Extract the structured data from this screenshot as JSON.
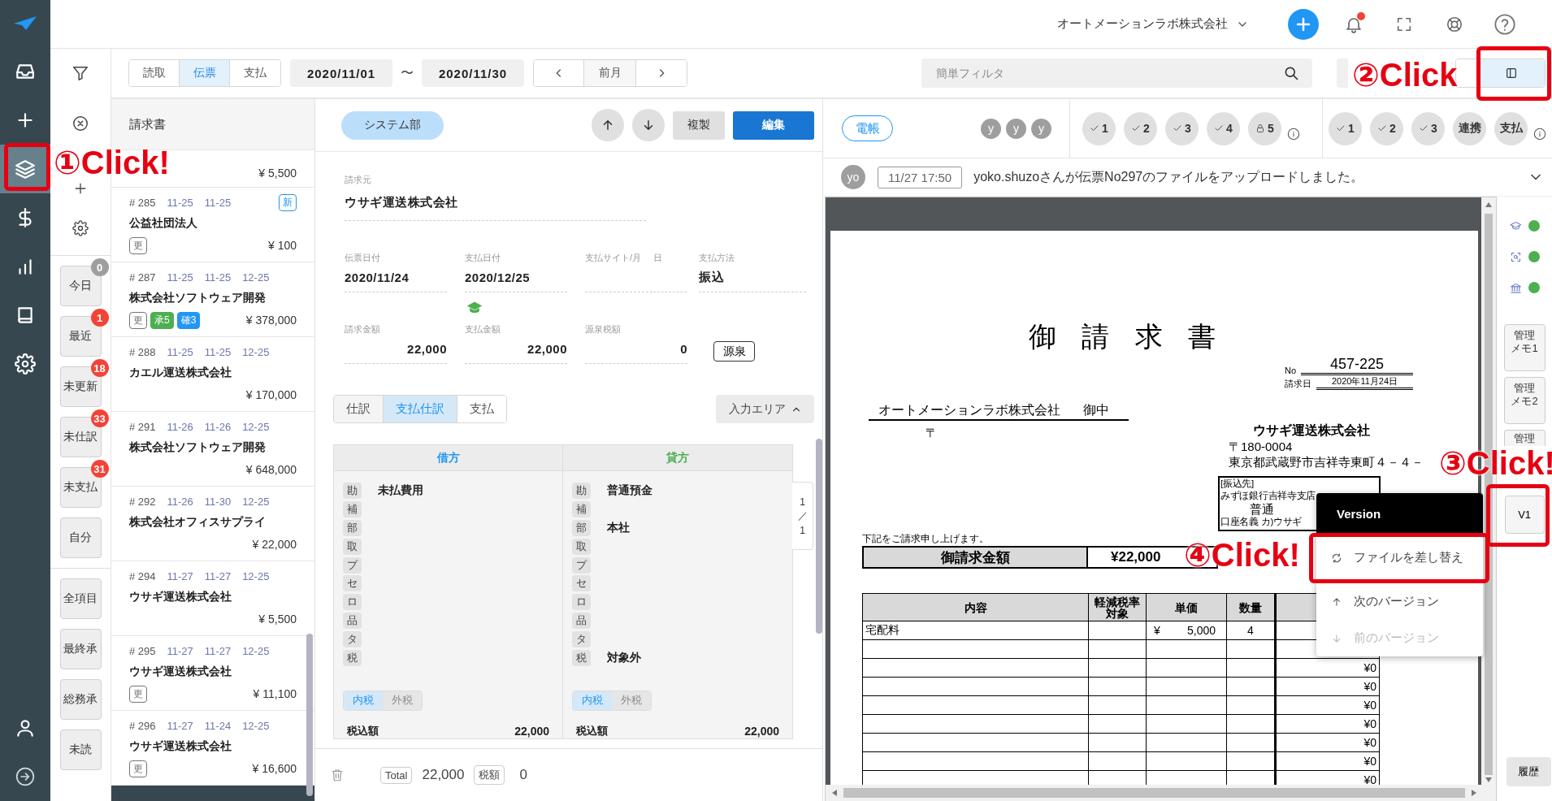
{
  "nav_rail": {
    "items": [
      {
        "selected": false
      },
      {
        "selected": false
      },
      {
        "selected": true
      },
      {
        "selected": false
      },
      {
        "selected": false
      },
      {
        "selected": false
      },
      {
        "selected": false
      }
    ]
  },
  "header": {
    "company": "オートメーションラボ株式会社",
    "unread_notifications": true
  },
  "toolbar": {
    "modes": [
      {
        "label": "読取",
        "selected": false
      },
      {
        "label": "伝票",
        "selected": true
      },
      {
        "label": "支払",
        "selected": false
      }
    ],
    "date_from": "2020/11/01",
    "range_separator": "〜",
    "date_to": "2020/11/30",
    "month_button": "前月",
    "search": {
      "placeholder": "簡単フィルタ"
    },
    "layout_toggle": [
      {
        "selected": false
      },
      {
        "selected": true
      }
    ]
  },
  "filters": {
    "quick": [
      {
        "label": "今日",
        "count": "0",
        "color": "#9e9e9e"
      },
      {
        "label": "最近",
        "count": "1",
        "color": "#f44336"
      },
      {
        "label": "未更新",
        "count": "18",
        "color": "#f44336"
      },
      {
        "label": "未仕訳",
        "count": "33",
        "color": "#f44336"
      },
      {
        "label": "未支払",
        "count": "31",
        "color": "#f44336"
      },
      {
        "label": "自分"
      }
    ],
    "approval": [
      {
        "label": "全項目"
      },
      {
        "label": "最終承"
      },
      {
        "label": "総務承"
      },
      {
        "label": "未読"
      }
    ]
  },
  "list": {
    "title": "請求書",
    "items": [
      {
        "amount": "¥ 5,500",
        "selected": false
      },
      {
        "number": "# 285",
        "dates": [
          "11-25",
          "11-25"
        ],
        "badge": "新",
        "name": "公益社団法人",
        "tags": [
          {
            "label": "更",
            "kind": "outline",
            "color": "#757575"
          }
        ],
        "amount": "¥ 100",
        "selected": false
      },
      {
        "number": "# 287",
        "dates": [
          "11-25",
          "11-25",
          "12-25"
        ],
        "name": "株式会社ソフトウェア開発",
        "tags": [
          {
            "label": "更",
            "kind": "outline",
            "color": "#757575"
          },
          {
            "label": "承5",
            "kind": "filled",
            "color": "#4caf50"
          },
          {
            "label": "確3",
            "kind": "filled",
            "color": "#2196f3"
          }
        ],
        "amount": "¥ 378,000",
        "selected": false
      },
      {
        "number": "# 288",
        "dates": [
          "11-25",
          "11-25",
          "12-25"
        ],
        "name": "カエル運送株式会社",
        "amount": "¥ 170,000",
        "selected": false
      },
      {
        "number": "# 291",
        "dates": [
          "11-26",
          "11-26",
          "12-25"
        ],
        "name": "株式会社ソフトウェア開発",
        "amount": "¥ 648,000",
        "selected": false
      },
      {
        "number": "# 292",
        "dates": [
          "11-26",
          "11-30",
          "12-25"
        ],
        "name": "株式会社オフィスサプライ",
        "amount": "¥ 22,000",
        "selected": false
      },
      {
        "number": "# 294",
        "dates": [
          "11-27",
          "11-27",
          "12-25"
        ],
        "name": "ウサギ運送株式会社",
        "amount": "¥ 5,500",
        "selected": false
      },
      {
        "number": "# 295",
        "dates": [
          "11-27",
          "11-27",
          "12-25"
        ],
        "name": "ウサギ運送株式会社",
        "tags": [
          {
            "label": "更",
            "kind": "outline",
            "color": "#757575"
          }
        ],
        "amount": "¥ 11,100",
        "selected": false
      },
      {
        "number": "# 296",
        "dates": [
          "11-27",
          "11-24",
          "12-25"
        ],
        "name": "ウサギ運送株式会社",
        "tags": [
          {
            "label": "更",
            "kind": "outline",
            "color": "#757575"
          }
        ],
        "amount": "¥ 16,600",
        "selected": false
      },
      {
        "selected": true
      }
    ]
  },
  "detail": {
    "department": "システム部",
    "copy_button": "複製",
    "edit_button": "編集",
    "biller": {
      "label": "請求元",
      "value": "ウサギ運送株式会社"
    },
    "date_fields": [
      {
        "label": "伝票日付",
        "value": "2020/11/24"
      },
      {
        "label": "支払日付",
        "value": "2020/12/25",
        "verified": true
      },
      {
        "label": "支払サイト/月"
      },
      {
        "label": "日"
      },
      {
        "label": "支払方法",
        "value": "振込"
      }
    ],
    "amount_fields": [
      {
        "label": "請求金額",
        "value": "22,000"
      },
      {
        "label": "支払金額",
        "value": "22,000"
      },
      {
        "label": "源泉税額",
        "value": "0"
      }
    ],
    "withholding_button": "源泉",
    "tabs": [
      {
        "label": "仕訳",
        "selected": false
      },
      {
        "label": "支払仕訳",
        "selected": true
      },
      {
        "label": "支払",
        "selected": false
      }
    ],
    "input_area_button": "入力エリア",
    "journal": {
      "sides": [
        {
          "title": "借方",
          "color": "#2196f3",
          "rows": [
            {
              "key": "勘",
              "value": "未払費用"
            },
            {
              "key": "補"
            },
            {
              "key": "部"
            },
            {
              "key": "取"
            },
            {
              "key": "プ"
            },
            {
              "key": "セ"
            },
            {
              "key": "ロ"
            },
            {
              "key": "品"
            },
            {
              "key": "タ"
            },
            {
              "key": "税"
            }
          ],
          "tax_modes": [
            {
              "label": "内税",
              "selected": true
            },
            {
              "label": "外税",
              "selected": false
            }
          ],
          "total_label": "税込額",
          "total": "22,000"
        },
        {
          "title": "貸方",
          "color": "#4caf50",
          "rows": [
            {
              "key": "勘",
              "value": "普通預金"
            },
            {
              "key": "補"
            },
            {
              "key": "部",
              "value": "本社"
            },
            {
              "key": "取"
            },
            {
              "key": "プ"
            },
            {
              "key": "セ"
            },
            {
              "key": "ロ"
            },
            {
              "key": "品"
            },
            {
              "key": "タ"
            },
            {
              "key": "税",
              "value": "対象外"
            }
          ],
          "tax_modes": [
            {
              "label": "内税",
              "selected": true
            },
            {
              "label": "外税",
              "selected": false
            }
          ],
          "total_label": "税込額",
          "total": "22,000"
        }
      ],
      "pager": [
        "1",
        "／",
        "1"
      ]
    },
    "footer": {
      "total_label": "Total",
      "total": "22,000",
      "tax_label": "税額",
      "tax": "0"
    }
  },
  "viewer": {
    "ledger_tag": "電帳",
    "approvers": [
      "y",
      "y",
      "y"
    ],
    "approval_steps": [
      {
        "label": "1",
        "kind": "check"
      },
      {
        "label": "2",
        "kind": "check"
      },
      {
        "label": "3",
        "kind": "check"
      },
      {
        "label": "4",
        "kind": "check"
      },
      {
        "label": "5",
        "kind": "lock"
      }
    ],
    "workflow_steps": [
      {
        "label": "1",
        "kind": "check"
      },
      {
        "label": "2",
        "kind": "check"
      },
      {
        "label": "3",
        "kind": "check"
      },
      {
        "label": "連携",
        "kind": "text"
      },
      {
        "label": "支払",
        "kind": "text"
      }
    ],
    "activity": {
      "avatar": "yo",
      "time": "11/27 17:50",
      "message": "yoko.shuzoさんが伝票No297のファイルをアップロードしました。"
    },
    "document": {
      "title": "御 請 求 書",
      "no_label": "No",
      "no": "457-225",
      "date_label": "請求日",
      "date": "2020年11月24日",
      "recipient": "オートメーションラボ株式会社",
      "honorific": "御中",
      "recipient_postal": "〒",
      "sender": "ウサギ運送株式会社",
      "sender_postal": "〒180-0004",
      "sender_address": "東京都武蔵野市吉祥寺東町４－４－",
      "bank_lines": [
        "[振込先]",
        "みずほ銀行吉祥寺支店",
        "普通",
        "口座名義 カ)ウサギ"
      ],
      "intro": "下記をご請求申し上げます。",
      "amount_label": "御請求金額",
      "amount": "¥22,000",
      "columns": [
        "内容",
        "軽減税率対象",
        "単価",
        "数量"
      ],
      "rows": [
        {
          "item": "宅配料",
          "currency": "¥",
          "unit_price": "5,000",
          "quantity": "4"
        },
        {},
        {
          "amount": "¥0"
        },
        {
          "amount": "¥0"
        },
        {
          "amount": "¥0"
        },
        {
          "amount": "¥0"
        },
        {
          "amount": "¥0"
        },
        {
          "amount": "¥0"
        },
        {
          "amount": "¥0"
        },
        {}
      ]
    },
    "status_icons": [
      {
        "color": "#4caf50"
      },
      {
        "color": "#4caf50"
      },
      {
        "color": "#4caf50"
      }
    ],
    "memo_buttons": [
      "管理メモ1",
      "管理メモ2",
      "管理"
    ],
    "version_button": "V1",
    "history_button": "履歴",
    "version_menu": {
      "title": "Version",
      "items": [
        {
          "label": "ファイルを差し替え",
          "disabled": false
        },
        {
          "label": "次のバージョン",
          "disabled": false
        },
        {
          "label": "前のバージョン",
          "disabled": true
        }
      ]
    }
  },
  "annotations": [
    {
      "text": "①Click!"
    },
    {
      "text": "②Click"
    },
    {
      "text": "③Click!"
    },
    {
      "text": "④Click!"
    }
  ]
}
